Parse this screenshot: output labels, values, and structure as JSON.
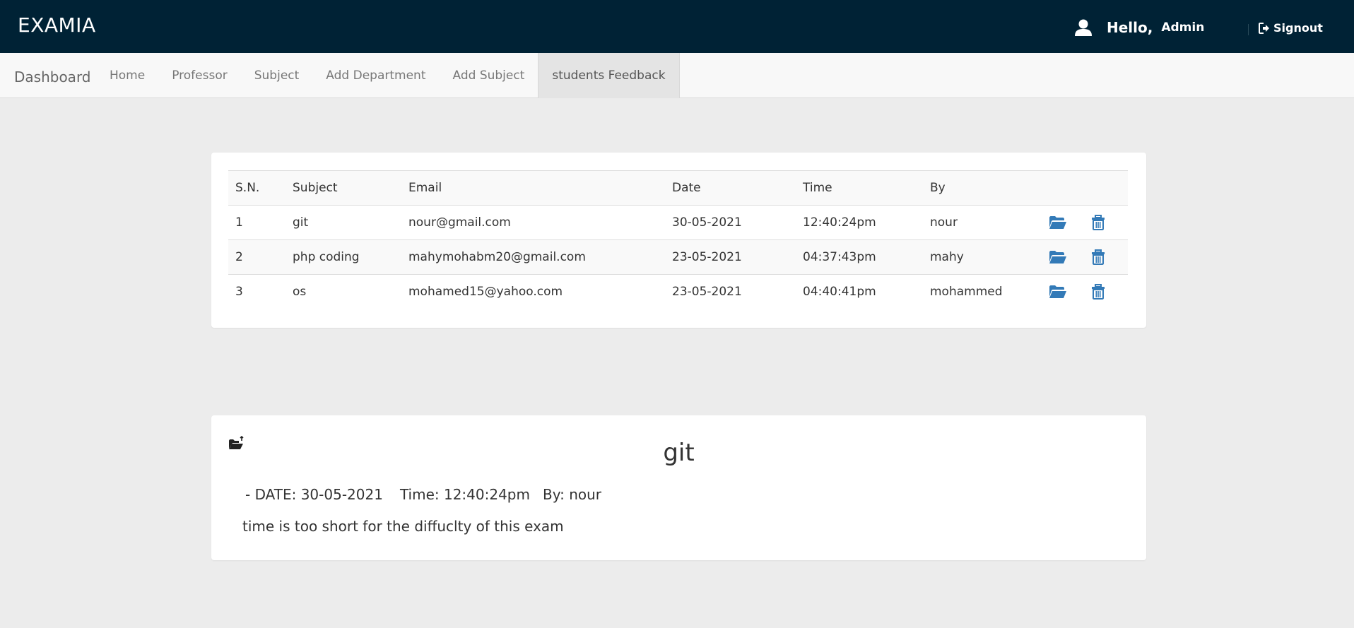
{
  "header": {
    "brand": "EXAMIA",
    "hello": "Hello,",
    "user": "Admin",
    "signout": "Signout"
  },
  "nav": {
    "brand": "Dashboard",
    "items": [
      {
        "label": "Home"
      },
      {
        "label": "Professor"
      },
      {
        "label": "Subject"
      },
      {
        "label": "Add Department"
      },
      {
        "label": "Add Subject"
      },
      {
        "label": "students Feedback"
      }
    ],
    "active": "students Feedback"
  },
  "table": {
    "columns": [
      "S.N.",
      "Subject",
      "Email",
      "Date",
      "Time",
      "By"
    ],
    "rows": [
      {
        "sn": "1",
        "subject": "git",
        "email": "nour@gmail.com",
        "date": "30-05-2021",
        "time": "12:40:24pm",
        "by": "nour"
      },
      {
        "sn": "2",
        "subject": "php coding",
        "email": "mahymohabm20@gmail.com",
        "date": "23-05-2021",
        "time": "04:37:43pm",
        "by": "mahy"
      },
      {
        "sn": "3",
        "subject": "os",
        "email": "mohamed15@yahoo.com",
        "date": "23-05-2021",
        "time": "04:40:41pm",
        "by": "mohammed"
      }
    ]
  },
  "detail": {
    "title": "git",
    "date_label": "- DATE:",
    "date": "30-05-2021",
    "time_label": "Time:",
    "time": "12:40:24pm",
    "by_label": "By:",
    "by": "nour",
    "message": "time is too short for the diffuclty of this exam"
  },
  "colors": {
    "header_bg": "#002235",
    "link": "#337ab7",
    "page_bg": "#ececec"
  },
  "icons": {
    "user": "user-icon",
    "signout": "signout-icon",
    "open": "folder-open-icon",
    "delete": "trash-icon",
    "back": "folder-back-icon"
  }
}
